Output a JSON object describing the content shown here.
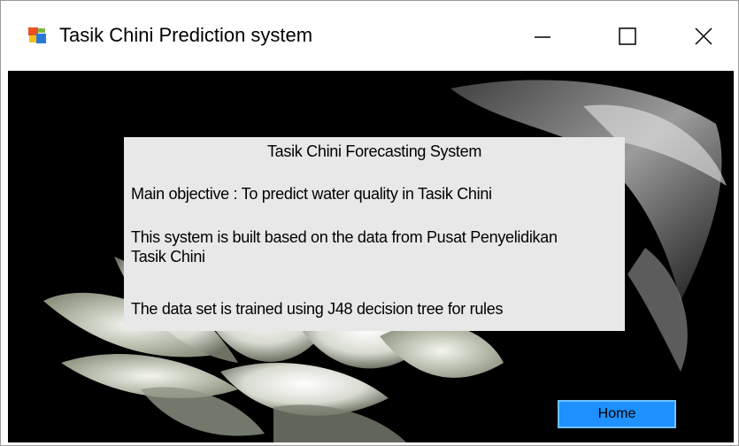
{
  "window": {
    "title": "Tasik Chini Prediction system",
    "icon": "app-form-icon",
    "controls": [
      "minimize-icon",
      "maximize-icon",
      "close-icon"
    ]
  },
  "panel": {
    "heading": "Tasik Chini Forecasting System",
    "line1": "Main objective : To predict water quality in Tasik Chini",
    "line2": "This system is built based on the  data from Pusat Penyelidikan Tasik Chini",
    "line3": "The data set is trained using J48 decision tree for rules"
  },
  "buttons": {
    "home": "Home"
  },
  "colors": {
    "background": "#000000",
    "panel": "#e8e8e8",
    "button": "#1e90ff",
    "button_border": "#6fc1ff"
  }
}
